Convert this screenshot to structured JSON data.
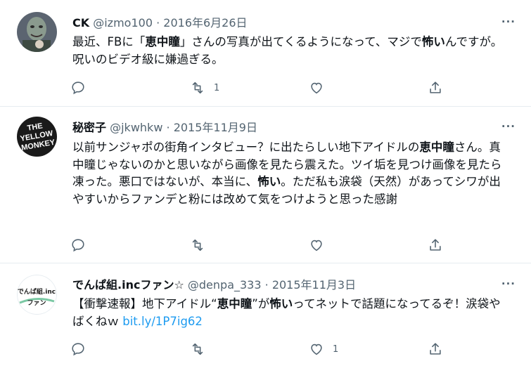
{
  "tweets": [
    {
      "name": "CK",
      "handle": "@izmo100",
      "date": "2016年6月26日",
      "text": [
        {
          "t": "最近、FBに「"
        },
        {
          "t": "恵中瞳",
          "b": true
        },
        {
          "t": "」さんの写真が出てくるようになって、マジで"
        },
        {
          "t": "怖い",
          "b": true
        },
        {
          "t": "んですが。呪いのビデオ級に嫌過ぎる。"
        }
      ],
      "reply_count": "",
      "retweet_count": "1",
      "like_count": "",
      "avatar_desc": "zombie-face-avatar"
    },
    {
      "name": "秘密子",
      "handle": "@jkwhkw",
      "date": "2015年11月9日",
      "text": [
        {
          "t": "以前サンジャポの街角インタビュー？に出たらしい地下アイドルの"
        },
        {
          "t": "恵中瞳",
          "b": true
        },
        {
          "t": "さん。真中瞳じゃないのかと思いながら画像を見たら震えた。ツイ垢を見つけ画像を見たら凍った。悪口ではないが、本当に、"
        },
        {
          "t": "怖い",
          "b": true
        },
        {
          "t": "。ただ私も涙袋（天然）があってシワが出やすいからファンデと粉には改めて気をつけようと思った感謝"
        }
      ],
      "reply_count": "",
      "retweet_count": "",
      "like_count": "",
      "avatar_text": [
        "THE",
        "YELLOW",
        "MONKEY"
      ]
    },
    {
      "name": "でんぱ組.incファン☆",
      "handle": "@denpa_333",
      "date": "2015年11月3日",
      "text": [
        {
          "t": "【衝撃速報】地下アイドル“"
        },
        {
          "t": "恵中瞳",
          "b": true
        },
        {
          "t": "”が"
        },
        {
          "t": "怖い",
          "b": true
        },
        {
          "t": "ってネットで話題になってるぞ！涙袋やばくねｗ "
        },
        {
          "t": "bit.ly/1P7ig62",
          "link": true
        }
      ],
      "reply_count": "",
      "retweet_count": "",
      "like_count": "1",
      "avatar_text": [
        "でんぱ組.inc",
        "ファン"
      ]
    }
  ],
  "separator": "·",
  "more_label": "···",
  "colors": {
    "link": "#1d9bf0",
    "muted": "#536471",
    "text": "#0f1419",
    "divider": "#e6ecf0"
  }
}
